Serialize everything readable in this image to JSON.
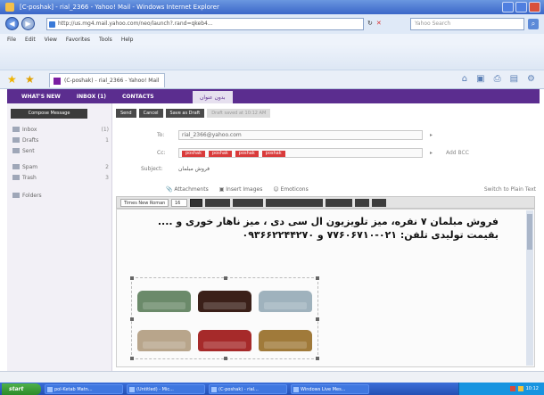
{
  "window": {
    "title": "[C-poshak] - rial_2366 - Yahoo! Mail - Windows Internet Explorer"
  },
  "address_bar": {
    "url": "http://us.mg4.mail.yahoo.com/neo/launch?.rand=qkeb4...",
    "search_placeholder": "Yahoo Search"
  },
  "menu": {
    "items": [
      "File",
      "Edit",
      "View",
      "Favorites",
      "Tools",
      "Help"
    ]
  },
  "favorites_tab": {
    "label": "(C-poshak) - rial_2366 - Yahoo! Mail"
  },
  "mail_nav": {
    "items": [
      "WHAT'S NEW",
      "INBOX (1)",
      "CONTACTS"
    ],
    "compose_tab": "بدون عنوان"
  },
  "sidebar": {
    "compose_label": "Compose Message",
    "folders": [
      {
        "label": "Inbox",
        "count": "(1)"
      },
      {
        "label": "Drafts",
        "count": "1"
      },
      {
        "label": "Sent",
        "count": ""
      },
      {
        "label": "Spam",
        "count": "2"
      },
      {
        "label": "Trash",
        "count": "3"
      },
      {
        "label": "Folders",
        "count": ""
      }
    ]
  },
  "compose": {
    "toolbar": [
      "Send",
      "Cancel",
      "Save as Draft"
    ],
    "toolbar_hint": "Draft saved at 10:12 AM",
    "to_label": "To:",
    "to_value": "rial_2366@yahoo.com",
    "cc_label": "Cc:",
    "cc_chips": [
      "poshak",
      "poshak",
      "poshak",
      "poshak"
    ],
    "bcc_label": "Add BCC",
    "subject_label": "Subject:",
    "subject_value": "فروش مبلمان",
    "attach_label": "Attachments",
    "insert_label": "Insert Images",
    "emoji_label": "Emoticons",
    "richtext_label": "Switch to Plain Text",
    "font_name": "Times New Roman",
    "font_size": "16",
    "body_text": "فروش مبلمان ۷ نفره، میز تلویزیون ال سی دی ، میز ناهار خوری و .... بقیمت تولیدی تلفن: ۰۲۱-۷۷۶۰۶۷۱۰ و ۰۹۳۶۶۲۲۴۴۲۷۰"
  },
  "sofa_colors": [
    "#6b8a6a",
    "#3b2019",
    "#9fb2bd",
    "#b8a58b",
    "#a62a2a",
    "#a07a3a"
  ],
  "taskbar": {
    "start_label": "start",
    "items": [
      "pol-Ketab Matn...",
      "(Untitled) - Mic...",
      "(C-poshak) - rial...",
      "Windows Live Mes..."
    ],
    "clock": "10:12"
  }
}
